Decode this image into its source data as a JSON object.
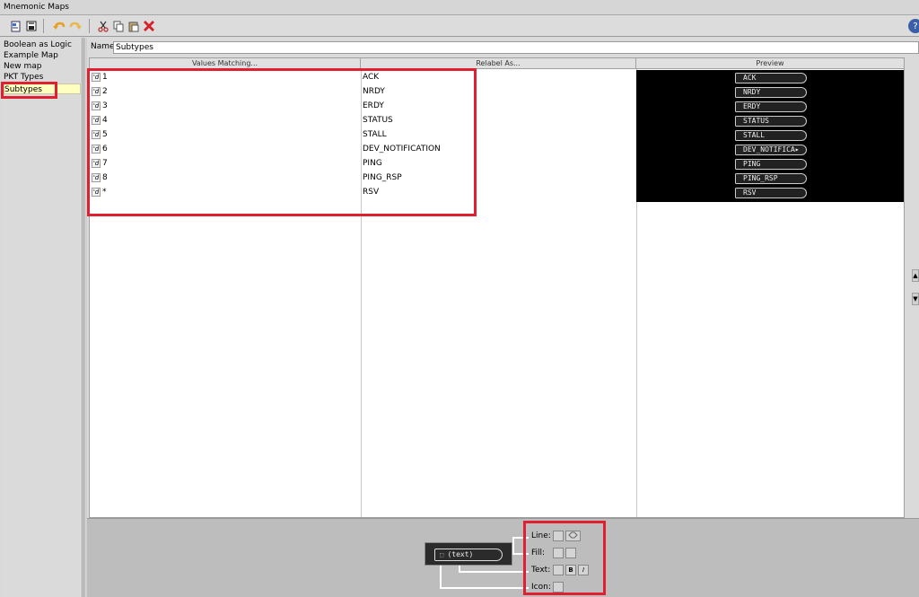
{
  "window": {
    "title": "Mnemonic Maps"
  },
  "toolbar": {
    "icons": [
      "new-map-icon",
      "save-icon",
      "undo-icon",
      "redo-icon",
      "cut-icon",
      "copy-icon",
      "paste-icon",
      "delete-icon",
      "help-icon"
    ],
    "delete_color": "#d4202a"
  },
  "sidebar": {
    "items": [
      {
        "label": "Boolean as Logic"
      },
      {
        "label": "Example Map"
      },
      {
        "label": "New map"
      },
      {
        "label": "PKT Types"
      },
      {
        "label": "Subtypes"
      }
    ],
    "selected_color": "#ffffbf"
  },
  "editor": {
    "name_label": "Name:",
    "name_value": "Subtypes",
    "columns": [
      "Values Matching...",
      "Relabel As...",
      "Preview"
    ],
    "rows": [
      {
        "badge": "'d",
        "value": "1",
        "relabel": "ACK"
      },
      {
        "badge": "'d",
        "value": "2",
        "relabel": "NRDY"
      },
      {
        "badge": "'d",
        "value": "3",
        "relabel": "ERDY"
      },
      {
        "badge": "'d",
        "value": "4",
        "relabel": "STATUS"
      },
      {
        "badge": "'d",
        "value": "5",
        "relabel": "STALL"
      },
      {
        "badge": "'d",
        "value": "6",
        "relabel": "DEV_NOTIFICATION"
      },
      {
        "badge": "'d",
        "value": "7",
        "relabel": "PING"
      },
      {
        "badge": "'d",
        "value": "8",
        "relabel": "PING_RSP"
      },
      {
        "badge": "'d",
        "value": "*",
        "relabel": "RSV"
      }
    ],
    "preview": [
      "ACK",
      "NRDY",
      "ERDY",
      "STATUS",
      "STALL",
      "DEV_NOTIFICA▸",
      "PING",
      "PING_RSP",
      "RSV"
    ]
  },
  "style_panel": {
    "preview_text": "(text)",
    "line_label": "Line:",
    "fill_label": "Fill:",
    "text_label": "Text:",
    "icon_label": "Icon:",
    "bold_glyph": "B",
    "italic_glyph": "I"
  },
  "highlight_color": "#e02030"
}
